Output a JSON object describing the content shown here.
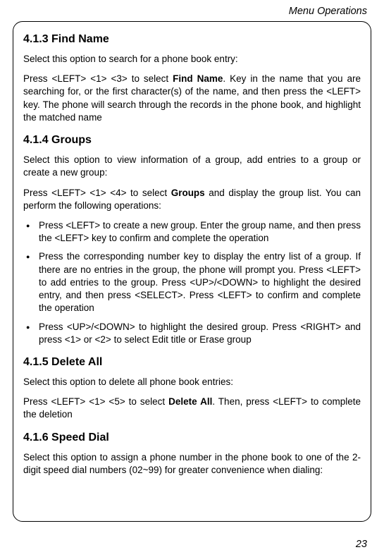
{
  "header": "Menu Operations",
  "s1": {
    "title": "4.1.3 Find Name",
    "p1": "Select this option to search for a phone book entry:",
    "p2a": "Press <LEFT> <1> <3> to select ",
    "p2b": "Find Name",
    "p2c": ". Key in the name that you are searching for, or the first character(s) of the name, and then press the <LEFT> key. The phone will search through the records in the phone book, and highlight the matched name"
  },
  "s2": {
    "title": "4.1.4 Groups",
    "p1": "Select this option to view information of a group, add entries to a group or create a new group:",
    "p2a": "Press <LEFT> <1> <4> to select ",
    "p2b": "Groups",
    "p2c": " and display the group list. You can perform the following operations:",
    "bul1": "Press <LEFT> to create a new group. Enter the group name, and then press the <LEFT> key to confirm and complete the operation",
    "bul2": "Press the corresponding number key to display the entry list of a group. If there are no entries in the group, the phone will prompt you. Press <LEFT> to add entries to the group. Press <UP>/<DOWN> to highlight the desired entry, and then press <SELECT>. Press <LEFT> to confirm and complete the operation",
    "bul3a": "Press <UP>/<DOWN> to highlight the desired group. Press <RIGHT> and press <1> or <2> to select ",
    "bul3b": "Edit title",
    "bul3c": " or ",
    "bul3d": "Erase group"
  },
  "s3": {
    "title": "4.1.5 Delete All",
    "p1": "Select this option to delete all phone book entries:",
    "p2a": "Press <LEFT> <1> <5> to select ",
    "p2b": "Delete All",
    "p2c": ". Then, press <LEFT> to complete the deletion"
  },
  "s4": {
    "title": "4.1.6 Speed Dial",
    "p1": "Select this option to assign a phone number in the phone book to one of the 2-digit speed dial numbers (02~99) for greater convenience when dialing:"
  },
  "pageNumber": "23"
}
